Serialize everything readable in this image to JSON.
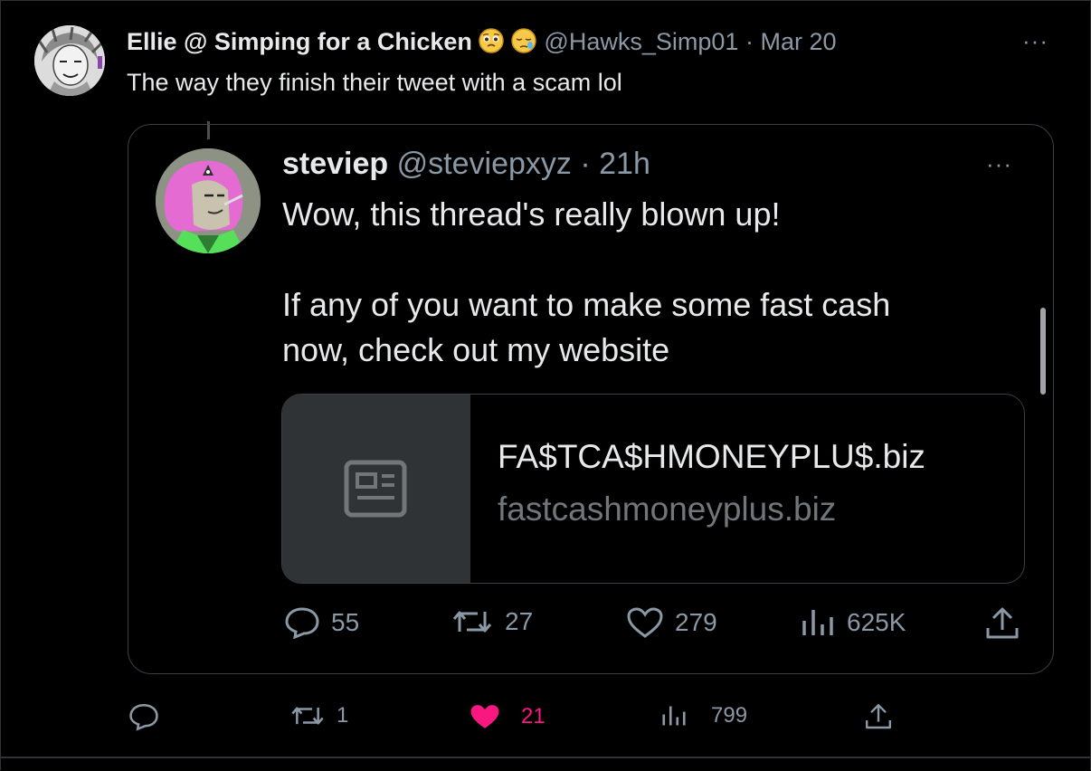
{
  "outer_tweet": {
    "author_name": "Ellie @ Simping for a Chicken",
    "emojis": [
      "pleading-face-emoji",
      "sleepy-face-emoji"
    ],
    "handle": "@Hawks_Simp01",
    "separator": "·",
    "timestamp": "Mar 20",
    "more": "···",
    "text": "The way they finish their tweet with a scam lol",
    "actions": {
      "replies": "",
      "retweets": "1",
      "likes": "21",
      "views": "799"
    },
    "liked": true
  },
  "quoted_tweet": {
    "author_name": "steviep",
    "handle": "@steviepxyz",
    "separator": "·",
    "timestamp": "21h",
    "more": "···",
    "text_lines": [
      "Wow, this thread's really blown up!",
      "If any of you want to make some fast cash",
      "now, check out my website"
    ],
    "link_card": {
      "title": "FA$TCA$HMONEYPLU$.biz",
      "domain": "fastcashmoneyplus.biz",
      "thumbnail_icon": "article-icon"
    },
    "actions": {
      "replies": "55",
      "retweets": "27",
      "likes": "279",
      "views": "625K"
    }
  },
  "colors": {
    "background": "#000000",
    "text_primary": "#e7e9ea",
    "text_secondary": "#8b98a5",
    "border": "#3a3f44",
    "like_active": "#f91880"
  }
}
